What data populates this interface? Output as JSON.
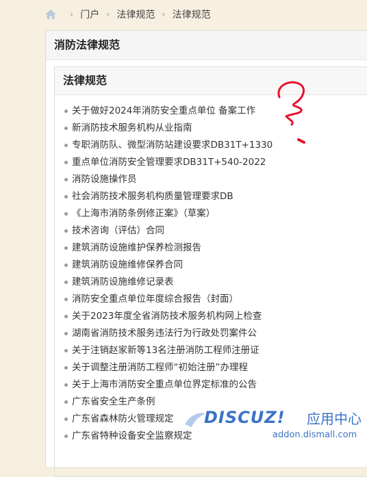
{
  "breadcrumb": {
    "items": [
      "门户",
      "法律规范",
      "法律规范"
    ]
  },
  "page_title": "消防法律规范",
  "section_title": "法律规范",
  "articles": [
    "关于做好2024年消防安全重点单位 备案工作",
    "新消防技术服务机构从业指南",
    "专职消防队、微型消防站建设要求DB31T+1330",
    "重点单位消防安全管理要求DB31T+540-2022",
    "消防设施操作员",
    "社会消防技术服务机构质量管理要求DB",
    "《上海市消防条例修正案》（草案）",
    "技术咨询（评估）合同",
    "建筑消防设施维护保养检测报告",
    "建筑消防设施维修保养合同",
    "建筑消防设施维修记录表",
    "消防安全重点单位年度综合报告（封面）",
    "关于2023年度全省消防技术服务机构网上检查",
    "湖南省消防技术服务违法行为行政处罚案件公",
    "关于注销赵家新等13名注册消防工程师注册证",
    "关于调整注册消防工程师“初始注册”办理程",
    "关于上海市消防安全重点单位界定标准的公告",
    "广东省安全生产条例",
    "广东省森林防火管理规定",
    "广东省特种设备安全监察规定"
  ],
  "watermark": {
    "logo": "DISCUZ!",
    "tagline": "应用中心",
    "url": "addon.dismall.com"
  },
  "colors": {
    "page_bg": "#f7f0e1",
    "scribble": "#e8112d",
    "watermark": "#3b73c8"
  }
}
